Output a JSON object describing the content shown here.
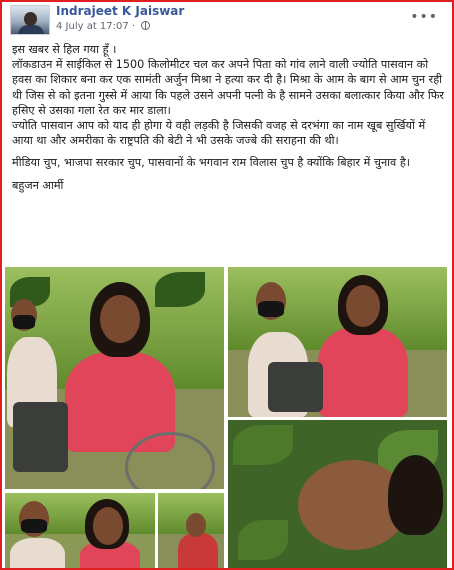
{
  "post": {
    "author": "Indrajeet K Jaiswar",
    "timestamp": "4 July at 17:07 ·",
    "paragraphs": [
      "इस खबर से हिल गया हूँ ।\nलॉकडाउन में साईकिल से 1500 किलोमीटर चल कर अपने पिता को गांव लाने वाली ज्योति पासवान को हवस का शिकार बना कर एक सामंती अर्जुन मिश्रा ने हत्या कर दी है। मिश्रा के आम के बाग से आम चुन रही थी जिस से को इतना गुस्से में आया कि पहले उसने अपनी पत्नी के है सामने उसका बलात्कार किया और फिर हसिए से उसका गला रेत कर मार डाला।\nज्योति पासवान आप को याद ही होगा ये वही लड़की है जिसकी वजह से दरभंगा का नाम खूब सुर्खियों में आया था और अमरीका के राष्ट्रपति की बेटी ने भी उसके जज्बे की सराहना की थी।",
      "मीडिया चुप, भाजपा सरकार चुप, पासवानों के भगवान राम विलास चुप है क्योंकि बिहार में चुनाव है।",
      "बहुजन आर्मी"
    ]
  },
  "icons": {
    "privacy": "globe-icon",
    "menu": "more-options-icon"
  },
  "menu_glyph": "•••",
  "colors": {
    "border": "#e02020",
    "author": "#385898"
  }
}
